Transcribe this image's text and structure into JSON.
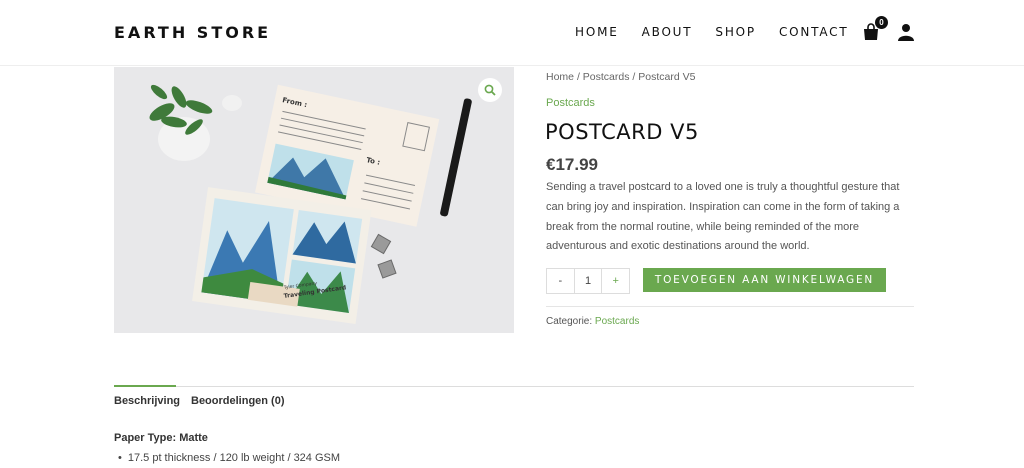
{
  "header": {
    "logo": "EARTH STORE",
    "nav": [
      "HOME",
      "ABOUT",
      "SHOP",
      "CONTACT"
    ],
    "cart_count": "0"
  },
  "product": {
    "breadcrumb": [
      "Home",
      "Postcards",
      "Postcard V5"
    ],
    "category": "Postcards",
    "title": "POSTCARD V5",
    "price": "€17.99",
    "description": "Sending a travel postcard to a loved one is truly a thoughtful gesture that can bring joy and inspiration. Inspiration can come in the form of taking a break from the normal routine, while being reminded of the more adventurous and exotic destinations around the world.",
    "quantity": "1",
    "qty_minus": "-",
    "qty_plus": "+",
    "add_to_cart": "TOEVOEGEN AAN WINKELWAGEN",
    "meta_label": "Categorie:",
    "meta_category": "Postcards",
    "image_text": {
      "from": "From :",
      "to": "To :",
      "card_title": "Tyler Company",
      "card_subtitle": "Traveling Postcard"
    }
  },
  "tabs": [
    "Beschrijving",
    "Beoordelingen (0)"
  ],
  "description_tab": {
    "spec_title": "Paper Type: Matte",
    "spec_items": [
      "17.5 pt thickness / 120 lb weight / 324 GSM"
    ]
  },
  "colors": {
    "accent": "#6aa84f",
    "text_dark": "#111111"
  }
}
